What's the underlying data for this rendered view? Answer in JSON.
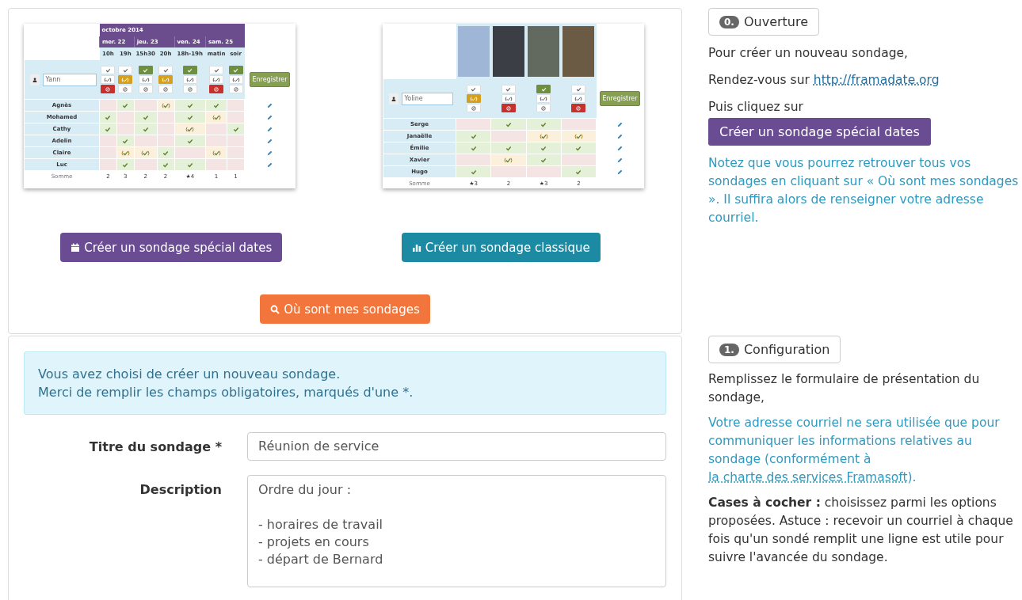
{
  "polls": [
    {
      "kind": "dates",
      "month": "octobre 2014",
      "days": [
        {
          "label": "mer. 22",
          "times": [
            "10h",
            "19h"
          ]
        },
        {
          "label": "jeu. 23",
          "times": [
            "15h30",
            "20h"
          ]
        },
        {
          "label": "ven. 24",
          "times": [
            "18h-19h"
          ]
        },
        {
          "label": "sam. 25",
          "times": [
            "matin",
            "soir"
          ]
        }
      ],
      "name_value": "Yann",
      "choices": [
        {
          "kind": "no"
        },
        {
          "kind": "maybe"
        },
        {
          "kind": "yes"
        },
        {
          "kind": "maybe"
        },
        {
          "kind": "yes"
        },
        {
          "kind": "no"
        },
        {
          "kind": "yes"
        }
      ],
      "save": "Enregistrer",
      "rows": [
        {
          "name": "Agnès",
          "votes": [
            {
              "kind": "no"
            },
            {
              "kind": "yes"
            },
            {
              "kind": "no"
            },
            {
              "kind": "maybe"
            },
            {
              "kind": "yes"
            },
            {
              "kind": "yes"
            },
            {
              "kind": "no"
            }
          ]
        },
        {
          "name": "Mohamed",
          "votes": [
            {
              "kind": "yes"
            },
            {
              "kind": "no"
            },
            {
              "kind": "yes"
            },
            {
              "kind": "no"
            },
            {
              "kind": "yes"
            },
            {
              "kind": "maybe"
            },
            {
              "kind": "no"
            }
          ]
        },
        {
          "name": "Cathy",
          "votes": [
            {
              "kind": "yes"
            },
            {
              "kind": "no"
            },
            {
              "kind": "yes"
            },
            {
              "kind": "no"
            },
            {
              "kind": "maybe"
            },
            {
              "kind": "no"
            },
            {
              "kind": "yes"
            }
          ]
        },
        {
          "name": "Adelin",
          "votes": [
            {
              "kind": "no"
            },
            {
              "kind": "yes"
            },
            {
              "kind": "no"
            },
            {
              "kind": "no"
            },
            {
              "kind": "yes"
            },
            {
              "kind": "no"
            },
            {
              "kind": "no"
            }
          ]
        },
        {
          "name": "Claire",
          "votes": [
            {
              "kind": "no"
            },
            {
              "kind": "maybe"
            },
            {
              "kind": "maybe"
            },
            {
              "kind": "yes"
            },
            {
              "kind": "no"
            },
            {
              "kind": "maybe"
            },
            {
              "kind": "no"
            }
          ]
        },
        {
          "name": "Luc",
          "votes": [
            {
              "kind": "no"
            },
            {
              "kind": "yes"
            },
            {
              "kind": "no"
            },
            {
              "kind": "yes"
            },
            {
              "kind": "yes"
            },
            {
              "kind": "no"
            },
            {
              "kind": "no"
            }
          ]
        }
      ],
      "sum_label": "Somme",
      "sums": [
        "2",
        "3",
        "2",
        "2",
        "★4",
        "1",
        "1"
      ]
    },
    {
      "kind": "posters",
      "name_value": "Yoline",
      "choices": [
        {
          "kind": "maybe"
        },
        {
          "kind": "no"
        },
        {
          "kind": "yes"
        },
        {
          "kind": "no"
        }
      ],
      "save": "Enregistrer",
      "rows": [
        {
          "name": "Serge",
          "votes": [
            {
              "kind": "no"
            },
            {
              "kind": "yes"
            },
            {
              "kind": "yes"
            },
            {
              "kind": "no"
            }
          ]
        },
        {
          "name": "Janaëlle",
          "votes": [
            {
              "kind": "yes"
            },
            {
              "kind": "no"
            },
            {
              "kind": "maybe"
            },
            {
              "kind": "maybe"
            }
          ]
        },
        {
          "name": "Émilie",
          "votes": [
            {
              "kind": "yes"
            },
            {
              "kind": "yes"
            },
            {
              "kind": "yes"
            },
            {
              "kind": "yes"
            }
          ]
        },
        {
          "name": "Xavier",
          "votes": [
            {
              "kind": "no"
            },
            {
              "kind": "maybe"
            },
            {
              "kind": "yes"
            },
            {
              "kind": "no"
            }
          ]
        },
        {
          "name": "Hugo",
          "votes": [
            {
              "kind": "yes"
            },
            {
              "kind": "no"
            },
            {
              "kind": "no"
            },
            {
              "kind": "yes"
            }
          ]
        }
      ],
      "sum_label": "Somme",
      "sums": [
        "★3",
        "2",
        "★3",
        "2"
      ]
    }
  ],
  "home_buttons": [
    {
      "kind": "dates",
      "label": "Créer un sondage spécial dates"
    },
    {
      "kind": "classic",
      "label": "Créer un sondage classique"
    },
    {
      "kind": "find",
      "label": "Où sont mes sondages"
    }
  ],
  "form": {
    "alert": [
      "Vous avez choisi de créer un nouveau sondage.",
      "Merci de remplir les champs obligatoires, marqués d'une *."
    ],
    "fields": [
      {
        "kind": "input",
        "label": "Titre du sondage *",
        "value": "Réunion de service"
      },
      {
        "kind": "textarea",
        "label": "Description",
        "value": "Ordre du jour :\n\n- horaires de travail\n- projets en cours\n- départ de Bernard"
      }
    ]
  },
  "guide": [
    {
      "step": "0.",
      "title": "Ouverture",
      "blocks": [
        {
          "kind": "text",
          "text": "Pour créer un nouveau sondage,"
        },
        {
          "kind": "link",
          "before": "Rendez-vous sur ",
          "link": "http://framadate.org"
        },
        {
          "kind": "text_tight",
          "text": "Puis cliquez sur"
        },
        {
          "kind": "button",
          "text": "Créer un sondage spécial dates"
        },
        {
          "kind": "note",
          "text": "Notez que vous pourrez retrouver tous vos sondages en cliquant sur « Où sont mes sondages ». Il suffira alors de renseigner votre adresse courriel."
        }
      ]
    },
    {
      "step": "1.",
      "title": "Configuration",
      "blocks": [
        {
          "kind": "text",
          "text": "Remplissez le formulaire de présentation du sondage,"
        },
        {
          "kind": "note_link",
          "before": "Votre adresse courriel ne sera utilisée que pour communiquer les informations relatives au sondage (conformément à ",
          "link": "la charte des services Framasoft",
          "after": ")."
        },
        {
          "kind": "text",
          "text": "**Cases à cocher :** choisissez parmi les options proposées. Astuce : recevoir un courriel à chaque fois qu'un sondé remplit une ligne est utile pour suivre l'avancée du sondage."
        }
      ]
    }
  ]
}
